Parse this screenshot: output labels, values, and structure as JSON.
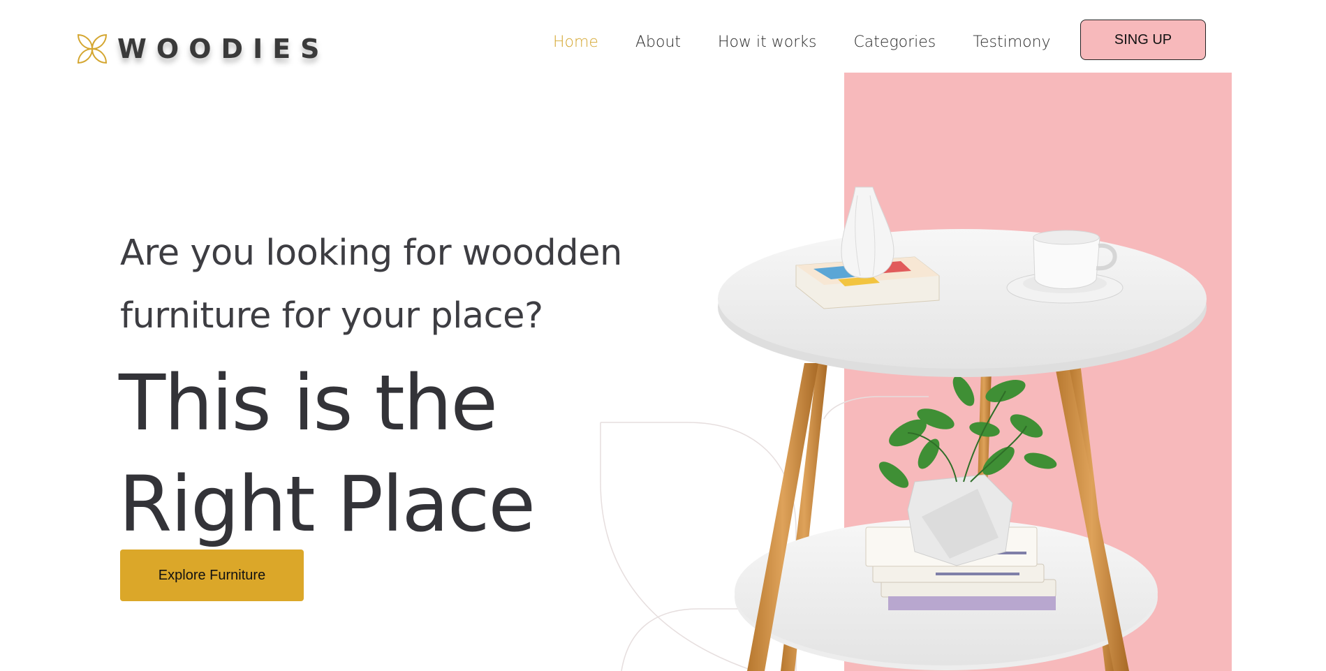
{
  "brand": {
    "name": "WOODIES",
    "accent": "#d4a630"
  },
  "nav": {
    "items": [
      {
        "label": "Home",
        "active": true
      },
      {
        "label": "About"
      },
      {
        "label": "How it works"
      },
      {
        "label": "Categories"
      },
      {
        "label": "Testimony"
      }
    ],
    "signup_label": "SING UP"
  },
  "hero": {
    "question_line1": "Are you looking for woodden",
    "question_line2": "furniture for your place?",
    "headline_line1": "This is the",
    "headline_line2": "Right Place",
    "cta_label": "Explore Furniture"
  },
  "colors": {
    "pink": "#f7b9bb",
    "gold": "#dba729",
    "text": "#333338"
  }
}
